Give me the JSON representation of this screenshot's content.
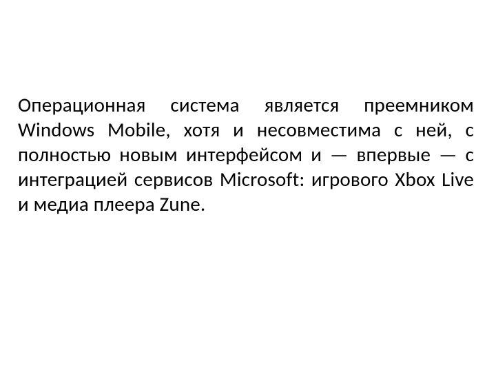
{
  "body": {
    "paragraph": "Операционная система является преемником Windows Mobile, хотя и несовместима с ней, с полностью новым интерфейсом и — впервые — с интеграцией сервисов Microsoft: игрового Xbox Live и медиа плеера Zune."
  }
}
